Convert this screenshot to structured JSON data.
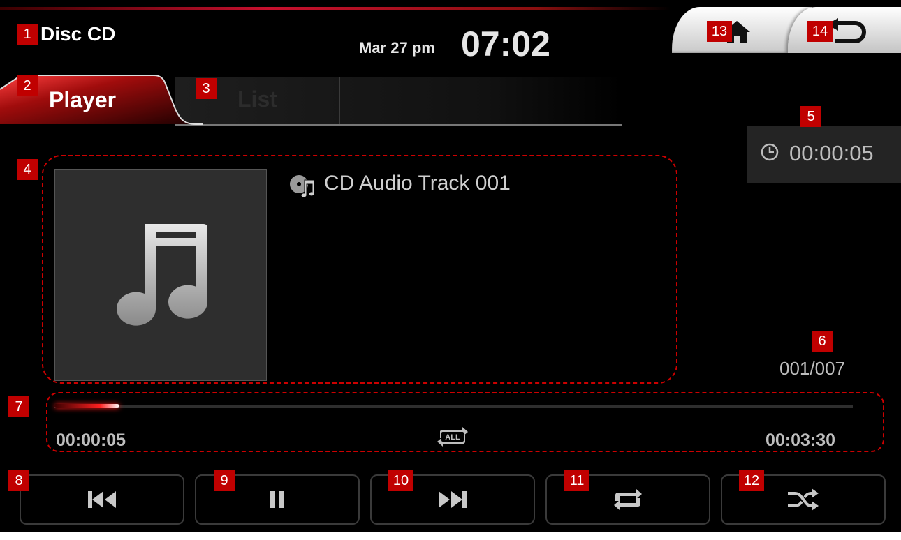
{
  "header": {
    "app_title": "Disc CD",
    "date": "Mar 27 pm",
    "time": "07:02",
    "home_icon": "home-icon",
    "back_icon": "back-arrow-icon"
  },
  "tabs": [
    {
      "label": "Player",
      "active": true
    },
    {
      "label": "List",
      "active": false
    }
  ],
  "timer": {
    "icon": "clock-icon",
    "value": "00:00:05"
  },
  "track": {
    "title": "CD Audio Track 001",
    "index": "001/007",
    "album_art_icon": "music-note-icon",
    "title_icon": "disc-music-icon"
  },
  "progress": {
    "elapsed": "00:00:05",
    "total": "00:03:30",
    "fraction": 0.024,
    "repeat_mode_icon": "repeat-all-icon"
  },
  "controls": [
    {
      "name": "previous-track-button",
      "icon": "skip-previous-icon"
    },
    {
      "name": "pause-button",
      "icon": "pause-icon"
    },
    {
      "name": "next-track-button",
      "icon": "skip-next-icon"
    },
    {
      "name": "repeat-button",
      "icon": "repeat-icon"
    },
    {
      "name": "shuffle-button",
      "icon": "shuffle-icon"
    }
  ],
  "annotations": [
    "1",
    "2",
    "3",
    "4",
    "5",
    "6",
    "7",
    "8",
    "9",
    "10",
    "11",
    "12",
    "13",
    "14"
  ],
  "colors": {
    "accent": "#c8102e",
    "annotation": "#c00000",
    "background": "#000000"
  }
}
